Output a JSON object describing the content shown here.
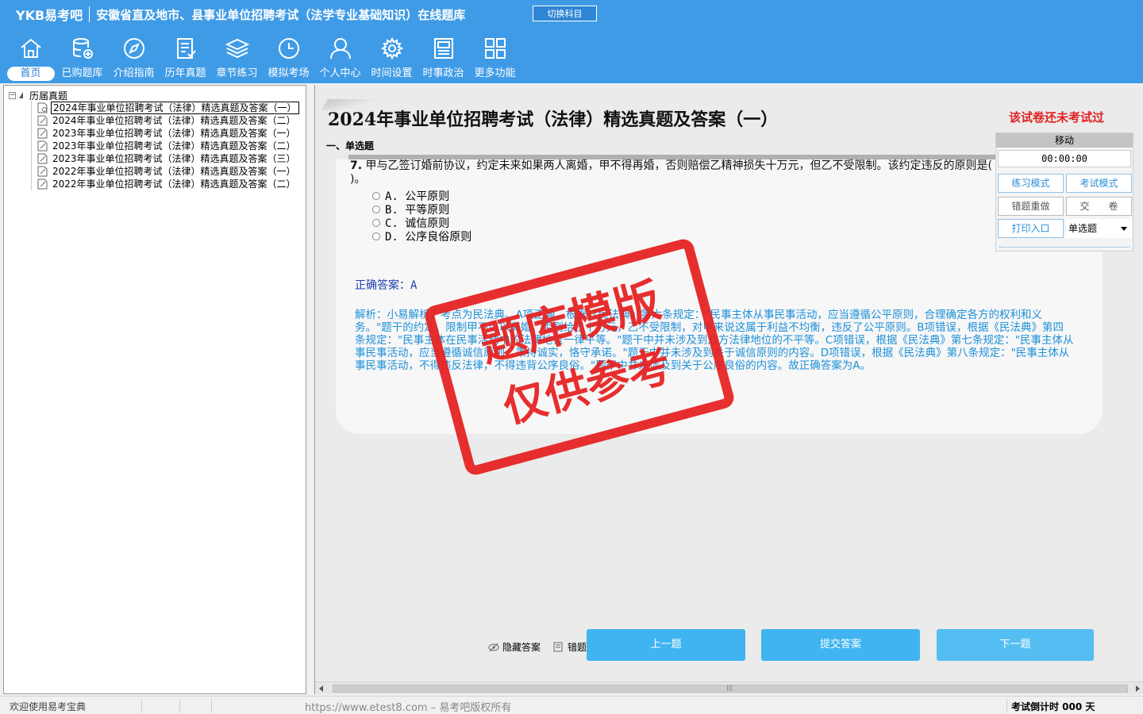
{
  "header": {
    "brand": "YKB易考吧",
    "title": "安徽省直及地市、县事业单位招聘考试（法学专业基础知识）在线题库",
    "switch_label": "切换科目"
  },
  "toolbar": [
    {
      "label": "首页",
      "icon": "home-icon"
    },
    {
      "label": "已购题库",
      "icon": "database-icon"
    },
    {
      "label": "介绍指南",
      "icon": "compass-icon"
    },
    {
      "label": "历年真题",
      "icon": "document-list-icon"
    },
    {
      "label": "章节练习",
      "icon": "layers-icon"
    },
    {
      "label": "模拟考场",
      "icon": "clock-icon"
    },
    {
      "label": "个人中心",
      "icon": "user-icon"
    },
    {
      "label": "时间设置",
      "icon": "gear-icon"
    },
    {
      "label": "时事政治",
      "icon": "newspaper-icon"
    },
    {
      "label": "更多功能",
      "icon": "grid-icon"
    }
  ],
  "tree": {
    "root": "历届真题",
    "items": [
      "2024年事业单位招聘考试（法律）精选真题及答案（一）",
      "2024年事业单位招聘考试（法律）精选真题及答案（二）",
      "2023年事业单位招聘考试（法律）精选真题及答案（一）",
      "2023年事业单位招聘考试（法律）精选真题及答案（二）",
      "2023年事业单位招聘考试（法律）精选真题及答案（三）",
      "2022年事业单位招聘考试（法律）精选真题及答案（一）",
      "2022年事业单位招聘考试（法律）精选真题及答案（二）"
    ]
  },
  "paper": {
    "title": "2024年事业单位招聘考试（法律）精选真题及答案（一）",
    "status": "该试卷还未考试过",
    "section": "一、单选题"
  },
  "question": {
    "number": "7.",
    "text": "甲与乙签订婚前协议，约定未来如果两人离婚，甲不得再婚，否则赔偿乙精神损失十万元，但乙不受限制。该约定违反的原则是( )。",
    "options": [
      "A. 公平原则",
      "B. 平等原则",
      "C. 诚信原则",
      "D. 公序良俗原则"
    ],
    "answer_label": "正确答案：",
    "answer_value": "A",
    "analysis": "解析：小易解析，考点为民法典。A项正确，根据《民法典》第六条规定：\"民事主体从事民事活动，应当遵循公平原则，合理确定各方的权利和义务。\"题干的约定，限制甲不可以离婚，否则给乙十万元，乙不受限制，对甲来说这属于利益不均衡，违反了公平原则。B项错误，根据《民法典》第四条规定：\"民事主体在民事活动中的法律地位一律平等。\"题干中并未涉及到双方法律地位的不平等。C项错误，根据《民法典》第七条规定：\"民事主体从事民事活动，应当遵循诚信原则，秉持诚实，恪守承诺。\"题干中并未涉及到关于诚信原则的内容。D项错误，根据《民法典》第八条规定：\"民事主体从事民事活动，不得违反法律，不得违背公序良俗。\"题干中并未涉及到关于公序良俗的内容。故正确答案为A。"
  },
  "stamp": {
    "line1": "题库模版",
    "line2": "仅供参考"
  },
  "side_panel": {
    "move_label": "移动",
    "timer": "00:00:00",
    "practice_mode": "练习模式",
    "exam_mode": "考试模式",
    "redo_wrong": "错题重做",
    "submit_paper": "交　　卷",
    "print_entry": "打印入口",
    "question_type": "单选题"
  },
  "controls": {
    "hide_answer": "隐藏答案",
    "wrong_book": "错题",
    "prev": "上一题",
    "submit": "提交答案",
    "next": "下一题"
  },
  "statusbar": {
    "welcome": "欢迎使用易考宝典",
    "copyright": "https://www.etest8.com – 易考吧版权所有",
    "countdown": "考试倒计时 000 天"
  },
  "colors": {
    "header_bg": "#3f9be6",
    "nav_button": "#3fb4f0",
    "status_red": "#e02020",
    "analysis_blue": "#1e90d8"
  }
}
